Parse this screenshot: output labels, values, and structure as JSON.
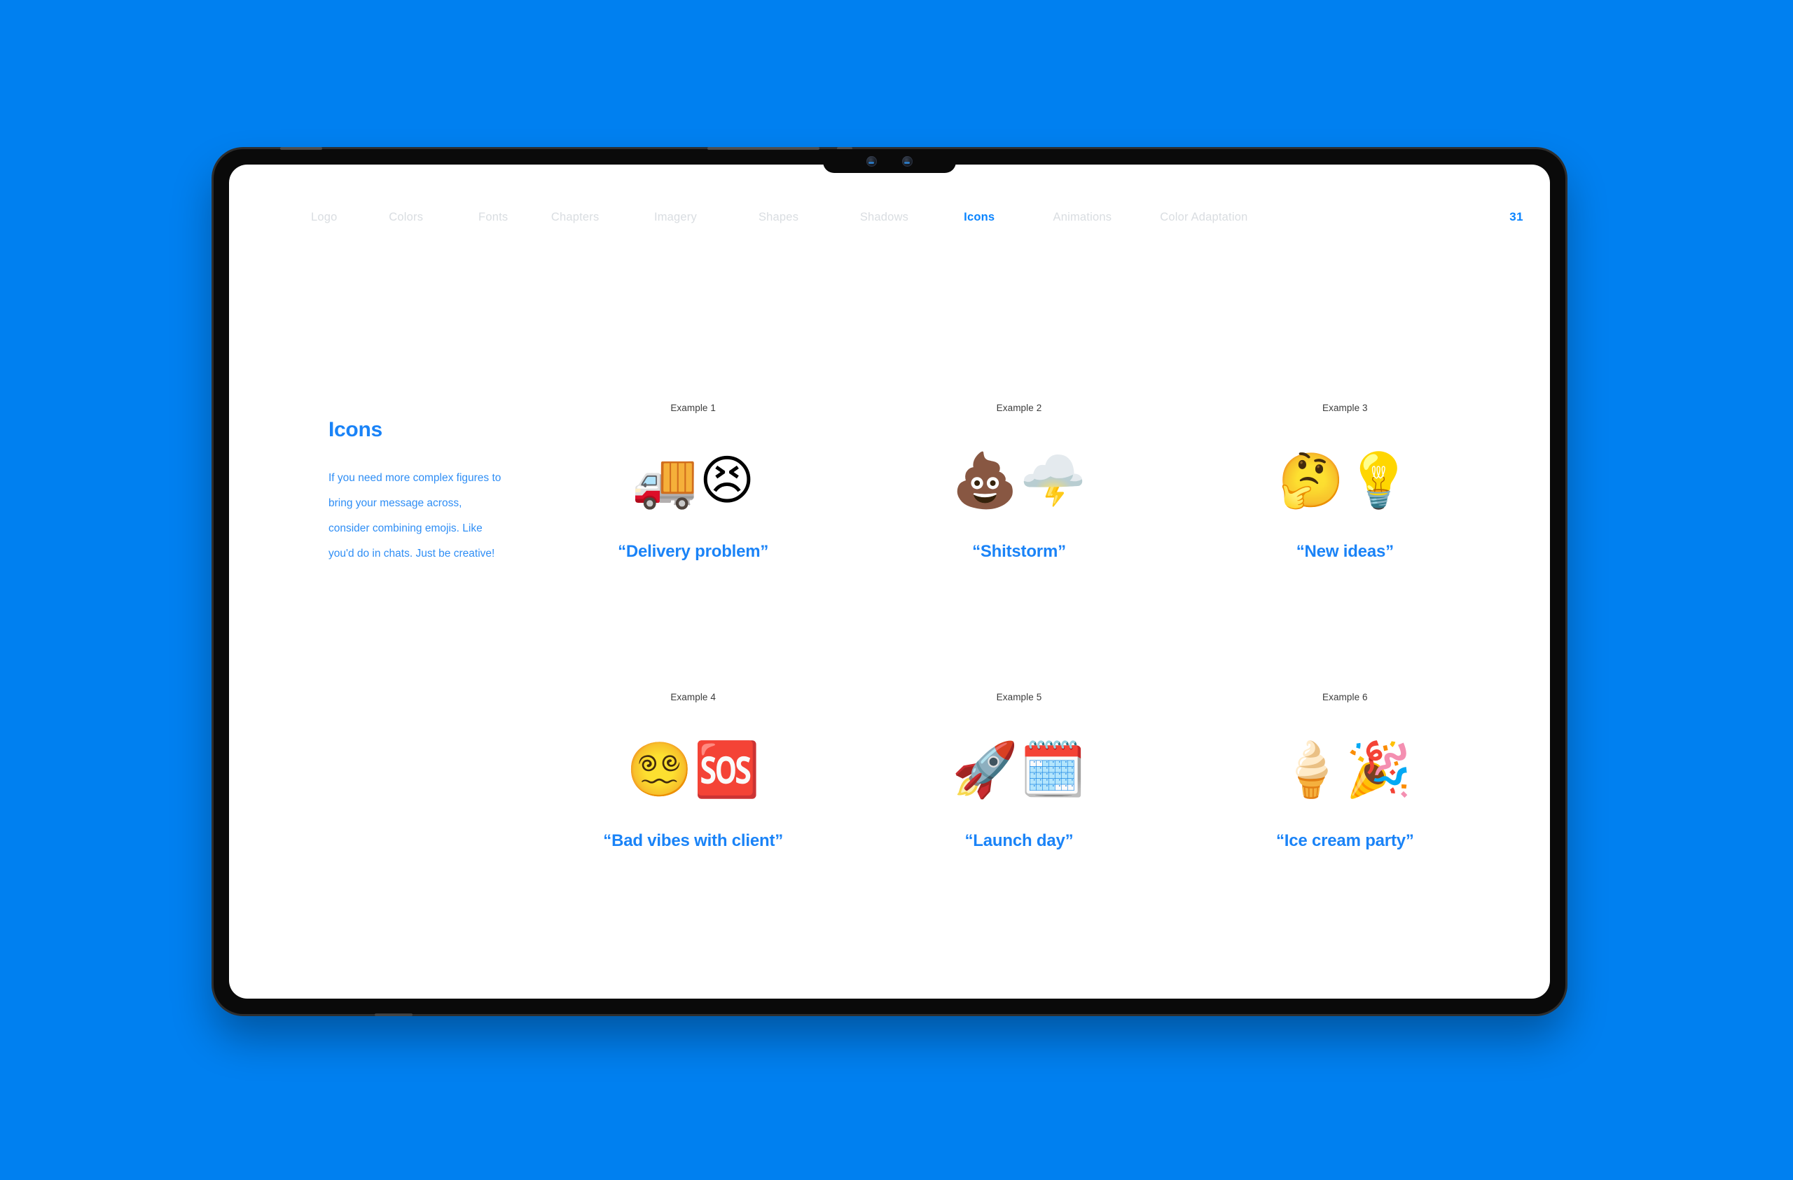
{
  "background_color": "#0080f0",
  "accent_color": "#1a83f7",
  "nav": {
    "items": [
      {
        "label": "Logo",
        "active": false
      },
      {
        "label": "Colors",
        "active": false
      },
      {
        "label": "Fonts",
        "active": false
      },
      {
        "label": "Chapters",
        "active": false
      },
      {
        "label": "Imagery",
        "active": false
      },
      {
        "label": "Shapes",
        "active": false
      },
      {
        "label": "Shadows",
        "active": false
      },
      {
        "label": "Icons",
        "active": true
      },
      {
        "label": "Animations",
        "active": false
      },
      {
        "label": "Color Adaptation",
        "active": false
      }
    ],
    "page_number": "31"
  },
  "intro": {
    "title": "Icons",
    "body": "If you need more complex figures to bring your message across, consider combining emojis. Like you'd do in chats. Just be creative!"
  },
  "examples": [
    {
      "caption": "Example 1",
      "label": "“Delivery problem”",
      "emojis": [
        "🚚",
        "😣"
      ],
      "emoji_names": [
        "delivery-truck-emoji",
        "persevering-face-emoji"
      ]
    },
    {
      "caption": "Example 2",
      "label": "“Shitstorm”",
      "emojis": [
        "💩",
        "🌩️"
      ],
      "emoji_names": [
        "pile-of-poo-emoji",
        "cloud-with-lightning-emoji"
      ]
    },
    {
      "caption": "Example 3",
      "label": "“New ideas”",
      "emojis": [
        "🤔",
        "💡"
      ],
      "emoji_names": [
        "thinking-face-emoji",
        "light-bulb-emoji"
      ]
    },
    {
      "caption": "Example 4",
      "label": "“Bad vibes with client”",
      "emojis": [
        "😵‍💫",
        "🆘"
      ],
      "emoji_names": [
        "face-with-spiral-eyes-emoji",
        "sos-button-emoji"
      ]
    },
    {
      "caption": "Example 5",
      "label": "“Launch day”",
      "emojis": [
        "🚀",
        "🗓️"
      ],
      "emoji_names": [
        "rocket-emoji",
        "spiral-calendar-emoji"
      ]
    },
    {
      "caption": "Example 6",
      "label": "“Ice cream party”",
      "emojis": [
        "🍦",
        "🎉"
      ],
      "emoji_names": [
        "soft-ice-cream-emoji",
        "party-popper-emoji"
      ]
    }
  ]
}
